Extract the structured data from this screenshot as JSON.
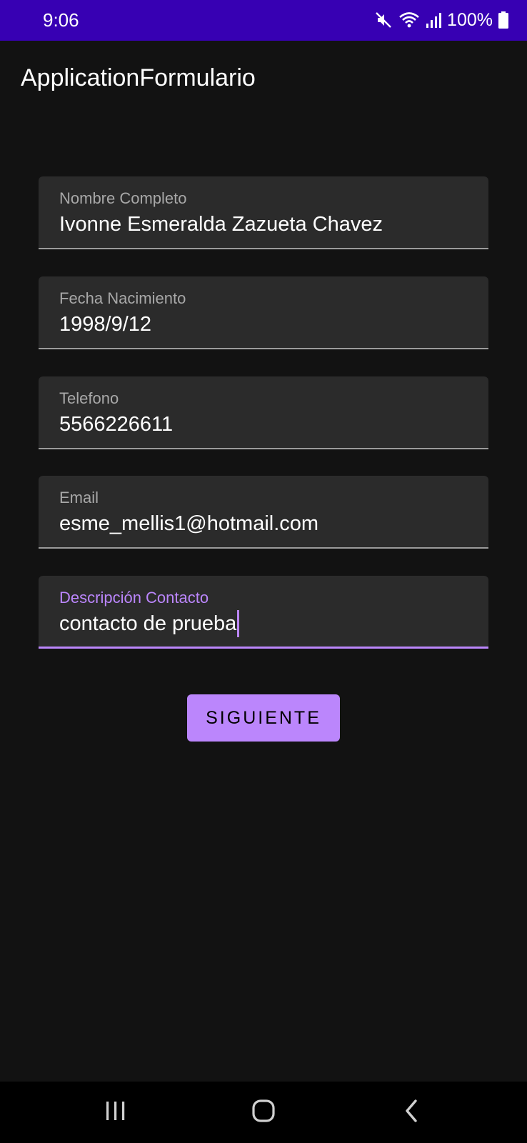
{
  "status_bar": {
    "time": "9:06",
    "battery": "100%",
    "icons": [
      "mute-icon",
      "wifi-icon",
      "signal-icon",
      "battery-icon"
    ]
  },
  "app_bar": {
    "title": "ApplicationFormulario"
  },
  "form": {
    "fields": [
      {
        "label": "Nombre Completo",
        "value": "Ivonne Esmeralda Zazueta Chavez",
        "focused": false
      },
      {
        "label": "Fecha Nacimiento",
        "value": "1998/9/12",
        "focused": false
      },
      {
        "label": "Telefono",
        "value": "5566226611",
        "focused": false
      },
      {
        "label": "Email",
        "value": "esme_mellis1@hotmail.com",
        "focused": false
      },
      {
        "label": "Descripción Contacto",
        "value": "contacto de prueba",
        "focused": true
      }
    ],
    "next_label": "SIGUIENTE"
  },
  "nav_bar": {
    "icons": [
      "recent-apps-icon",
      "home-icon",
      "back-icon"
    ]
  },
  "colors": {
    "status_bar": "#3700b3",
    "accent": "#bb86fc",
    "background": "#121212",
    "field_bg": "#2b2b2b"
  }
}
